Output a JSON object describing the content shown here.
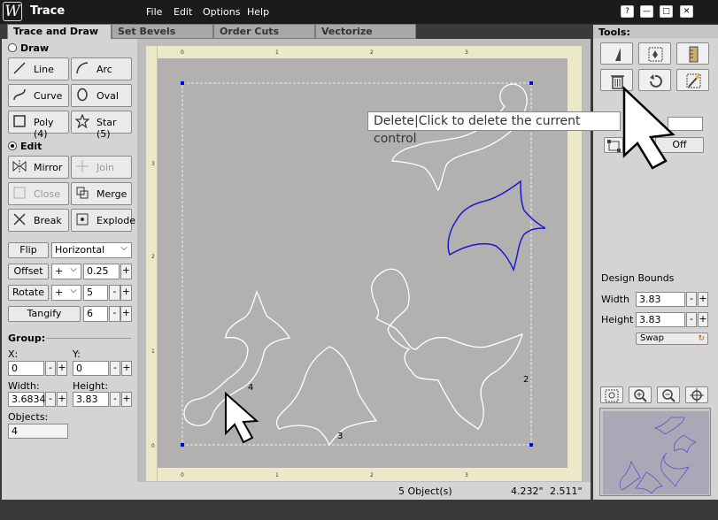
{
  "app": {
    "title": "Trace",
    "logo_glyph": "W"
  },
  "menu": [
    "File",
    "Edit",
    "Options",
    "Help"
  ],
  "window_buttons": [
    "?",
    "—",
    "□",
    "✕"
  ],
  "tabs": [
    "Trace and Draw",
    "Set Bevels",
    "Order Cuts",
    "Vectorize"
  ],
  "left": {
    "draw_label": "Draw",
    "draw_buttons": {
      "line": "Line",
      "arc": "Arc",
      "curve": "Curve",
      "oval": "Oval",
      "poly": "Poly (4)",
      "star": "Star (5)"
    },
    "edit_label": "Edit",
    "edit_buttons": {
      "mirror": "Mirror",
      "join": "Join",
      "close": "Close",
      "merge": "Merge",
      "break": "Break",
      "explode": "Explode"
    },
    "flip": {
      "button": "Flip",
      "value": "Horizontal"
    },
    "offset": {
      "button": "Offset",
      "sign": "+",
      "value": "0.25"
    },
    "rotate": {
      "button": "Rotate",
      "sign": "+",
      "value": "5"
    },
    "tangify": {
      "button": "Tangify",
      "value": "6"
    },
    "group": {
      "label": "Group:",
      "x_label": "X:",
      "y_label": "Y:",
      "x": "0",
      "y": "0",
      "width_label": "Width:",
      "height_label": "Height:",
      "width": "3.6834",
      "height": "3.83",
      "objects_label": "Objects:",
      "objects": "4"
    },
    "minus": "-",
    "plus": "+"
  },
  "canvas": {
    "labels": {
      "shape4": "4",
      "shape3": "3",
      "shape2": "2"
    },
    "ruler_top": [
      "0",
      "1",
      "2",
      "3"
    ],
    "ruler_left": [
      "3",
      "2",
      "1",
      "0"
    ]
  },
  "status": {
    "objects": "5 Object(s)",
    "x": "4.232\"",
    "y": "2.511\""
  },
  "right": {
    "tools_label": "Tools:",
    "off_label": "Off",
    "design_bounds_label": "Design Bounds",
    "width_label": "Width",
    "width": "3.83",
    "height_label": "Height",
    "height": "3.83",
    "swap": "Swap"
  },
  "tooltip": "Delete|Click to delete the current control",
  "colors": {
    "selected_shape": "#1a1ad0",
    "shape": "#ffffff",
    "canvas_grey": "#b3b1b0",
    "canvas_border": "#ece9c9"
  }
}
